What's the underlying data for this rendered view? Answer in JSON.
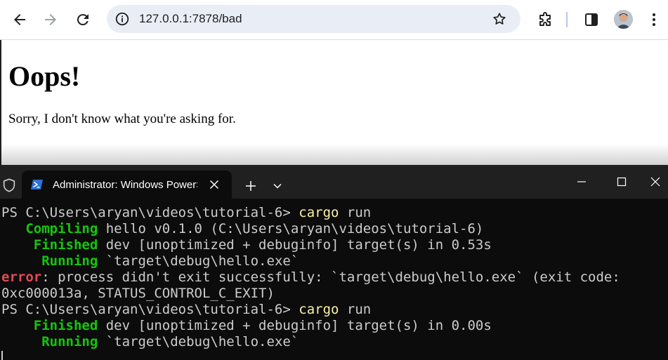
{
  "browser": {
    "url": "127.0.0.1:7878/bad"
  },
  "page": {
    "heading": "Oops!",
    "message": "Sorry, I don't know what you're asking for."
  },
  "terminal": {
    "tab_title": "Administrator: Windows PowerShell",
    "lines": [
      {
        "parts": [
          {
            "t": "PS C:\\Users\\aryan\\videos\\tutorial-6> "
          },
          {
            "t": "cargo",
            "c": "y"
          },
          {
            "t": " run"
          }
        ]
      },
      {
        "parts": [
          {
            "t": "   "
          },
          {
            "t": "Compiling",
            "c": "g"
          },
          {
            "t": " hello v0.1.0 (C:\\Users\\aryan\\videos\\tutorial-6)"
          }
        ]
      },
      {
        "parts": [
          {
            "t": "    "
          },
          {
            "t": "Finished",
            "c": "g"
          },
          {
            "t": " dev [unoptimized + debuginfo] target(s) in 0.53s"
          }
        ]
      },
      {
        "parts": [
          {
            "t": "     "
          },
          {
            "t": "Running",
            "c": "g"
          },
          {
            "t": " `target\\debug\\hello.exe`"
          }
        ]
      },
      {
        "parts": [
          {
            "t": "error",
            "c": "r"
          },
          {
            "t": ": process didn't exit successfully: `target\\debug\\hello.exe` (exit code:"
          }
        ]
      },
      {
        "parts": [
          {
            "t": "0xc000013a, STATUS_CONTROL_C_EXIT)"
          }
        ]
      },
      {
        "parts": [
          {
            "t": "PS C:\\Users\\aryan\\videos\\tutorial-6> "
          },
          {
            "t": "cargo",
            "c": "y"
          },
          {
            "t": " run"
          }
        ]
      },
      {
        "parts": [
          {
            "t": "    "
          },
          {
            "t": "Finished",
            "c": "g"
          },
          {
            "t": " dev [unoptimized + debuginfo] target(s) in 0.00s"
          }
        ]
      },
      {
        "parts": [
          {
            "t": "     "
          },
          {
            "t": "Running",
            "c": "g"
          },
          {
            "t": " `target\\debug\\hello.exe`"
          }
        ]
      }
    ]
  },
  "colors": {
    "terminal_green": "#16c60c",
    "terminal_yellow": "#f9f1a5",
    "terminal_red": "#e74856",
    "terminal_text": "#cccccc"
  },
  "icons": [
    "back-icon",
    "forward-icon",
    "reload-icon",
    "site-info-icon",
    "star-icon",
    "extensions-icon",
    "side-panel-icon",
    "avatar",
    "chrome-menu-icon",
    "shield-icon",
    "powershell-icon",
    "close-icon",
    "plus-icon",
    "chevron-down-icon",
    "minimize-icon",
    "maximize-icon",
    "window-close-icon"
  ]
}
